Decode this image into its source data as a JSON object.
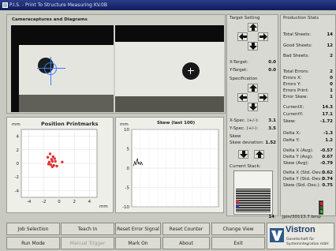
{
  "window": {
    "title": "P.I.S. - Print To Structure Measuring KV.0B"
  },
  "camera": {
    "title": "Cameracaptures and Diagrams"
  },
  "target": {
    "title": "Target Setting",
    "x_label": "X-Target:",
    "x_value": "0.0",
    "y_label": "Y-Target:",
    "y_value": "0.0",
    "spec_title": "Specification",
    "xspec_label": "X-Spec. (+/-):",
    "xspec_value": "3.1",
    "yspec_label": "Y-Spec. (+/-):",
    "yspec_value": "3.5",
    "skew_label": "Skew",
    "skewdev_label": "Skew deviation:",
    "skewdev_value": "1.52"
  },
  "stack": {
    "title": "Current Stack:",
    "count": "14",
    "file": "Jpin/30113.7.bmp"
  },
  "stats": {
    "title": "Production Stats",
    "total_label": "Total Sheets:",
    "total_value": "14",
    "good_label": "Good Sheets:",
    "good_value": "12",
    "bad_label": "Bad Sheets:",
    "bad_value": "2",
    "errors": [
      {
        "label": "Total Errors:",
        "value": "2"
      },
      {
        "label": "Errors X:",
        "value": "0"
      },
      {
        "label": "Errors Y:",
        "value": "0"
      },
      {
        "label": "Errors Print:",
        "value": "1"
      },
      {
        "label": "Error Skew:",
        "value": "1"
      }
    ],
    "current": [
      {
        "label": "CurrentX:",
        "value": "14.3"
      },
      {
        "label": "CurrentY:",
        "value": "17.1"
      },
      {
        "label": "Skew:",
        "value": "-1.72"
      }
    ],
    "delta": [
      {
        "label": "Delta X:",
        "value": "-1.3"
      },
      {
        "label": "Delta Y:",
        "value": "1.2"
      }
    ],
    "avg": [
      {
        "label": "Delta X (Avg):",
        "value": "-0.57"
      },
      {
        "label": "Delta Y (Avg):",
        "value": "0.67"
      },
      {
        "label": "Skew (Avg):",
        "value": "-0.79"
      }
    ],
    "std": [
      {
        "label": "Delta X (Std.-Dev.):",
        "value": "0.62"
      },
      {
        "label": "Delta Y (Std.-Dev.):",
        "value": "0.74"
      },
      {
        "label": "Skew (Std.-Dev.):",
        "value": "0.75"
      }
    ]
  },
  "buttons": {
    "row1": [
      "Job Selection",
      "Teach In",
      "Reset Error Signal",
      "Reset Counter",
      "Change View"
    ],
    "row2": [
      "Run Mode",
      "Manual Trigger",
      "Mark On",
      "About",
      "Exit"
    ]
  },
  "logo": {
    "name": "Vistron",
    "line1": "Gesellschaft für",
    "line2": "Systemintegration mbH"
  },
  "chart_data": [
    {
      "type": "scatter",
      "title": "Position Printmarks",
      "xlabel": "mm",
      "ylabel": "mm",
      "xlim": [
        -5,
        5
      ],
      "ylim": [
        -5,
        5
      ],
      "xticks": [
        -4,
        -2,
        0,
        2,
        4
      ],
      "yticks": [
        4,
        2,
        0,
        -2,
        -4
      ],
      "points": [
        [
          -1.2,
          1.4
        ],
        [
          -0.8,
          1.0
        ],
        [
          -1.5,
          0.9
        ],
        [
          -1.0,
          0.6
        ],
        [
          -0.6,
          0.7
        ],
        [
          -1.3,
          0.2
        ],
        [
          -0.9,
          0.3
        ],
        [
          -0.5,
          0.3
        ],
        [
          0.4,
          0.2
        ],
        [
          -1.1,
          -0.2
        ],
        [
          -0.7,
          -0.3
        ],
        [
          -0.9,
          -0.5
        ],
        [
          -1.4,
          -0.1
        ],
        [
          -0.3,
          -0.4
        ]
      ],
      "color": "#e53030"
    },
    {
      "type": "line",
      "title": "Skew (last 100)",
      "xlabel": "",
      "ylabel": "mm",
      "ylim": [
        -10,
        10
      ],
      "yticks": [
        10,
        5,
        0,
        -5,
        -10
      ],
      "values": [
        0.5,
        1.0,
        1.8,
        1.0,
        0.9,
        2.0,
        2.5,
        1.0,
        1.5,
        1.2,
        0.9,
        1.6,
        1.3,
        0.8
      ],
      "color": "#111111"
    }
  ]
}
